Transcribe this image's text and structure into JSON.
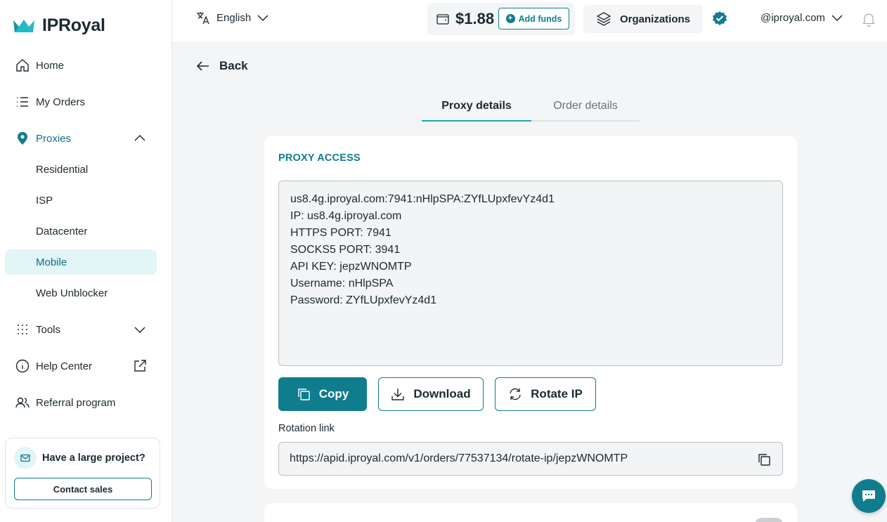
{
  "brand": {
    "name": "IPRoyal",
    "accent": "#0f7d8e",
    "accent_light": "#e2f5f7"
  },
  "sidebar": {
    "items": [
      {
        "label": "Home",
        "icon": "home-icon"
      },
      {
        "label": "My Orders",
        "icon": "list-icon"
      },
      {
        "label": "Proxies",
        "icon": "location-pin-icon",
        "expanded": true
      },
      {
        "label": "Tools",
        "icon": "grid-dots-icon",
        "expanded": false
      },
      {
        "label": "Help Center",
        "icon": "info-icon"
      },
      {
        "label": "Referral program",
        "icon": "users-icon"
      }
    ],
    "proxy_subitems": [
      {
        "label": "Residential"
      },
      {
        "label": "ISP"
      },
      {
        "label": "Datacenter"
      },
      {
        "label": "Mobile",
        "active": true
      },
      {
        "label": "Web Unblocker"
      }
    ],
    "promo": {
      "title": "Have a large project?",
      "button": "Contact sales"
    }
  },
  "topbar": {
    "language": "English",
    "balance": "$1.88",
    "add_funds": "Add funds",
    "organizations": "Organizations",
    "account": "@iproyal.com"
  },
  "main": {
    "back": "Back",
    "tabs": [
      {
        "label": "Proxy details",
        "active": true
      },
      {
        "label": "Order details",
        "active": false
      }
    ],
    "proxy_access": {
      "title": "PROXY ACCESS",
      "lines": [
        "us8.4g.iproyal.com:7941:nHlpSPA:ZYfLUpxfevYz4d1",
        "IP: us8.4g.iproyal.com",
        "HTTPS PORT: 7941",
        "SOCKS5 PORT: 3941",
        "API KEY: jepzWNOMTP",
        "Username: nHlpSPA",
        "Password: ZYfLUpxfevYz4d1"
      ],
      "buttons": {
        "copy": "Copy",
        "download": "Download",
        "rotate": "Rotate IP"
      },
      "rotation_label": "Rotation link",
      "rotation_link": "https://apid.iproyal.com/v1/orders/77537134/rotate-ip/jepzWNOMTP"
    }
  }
}
